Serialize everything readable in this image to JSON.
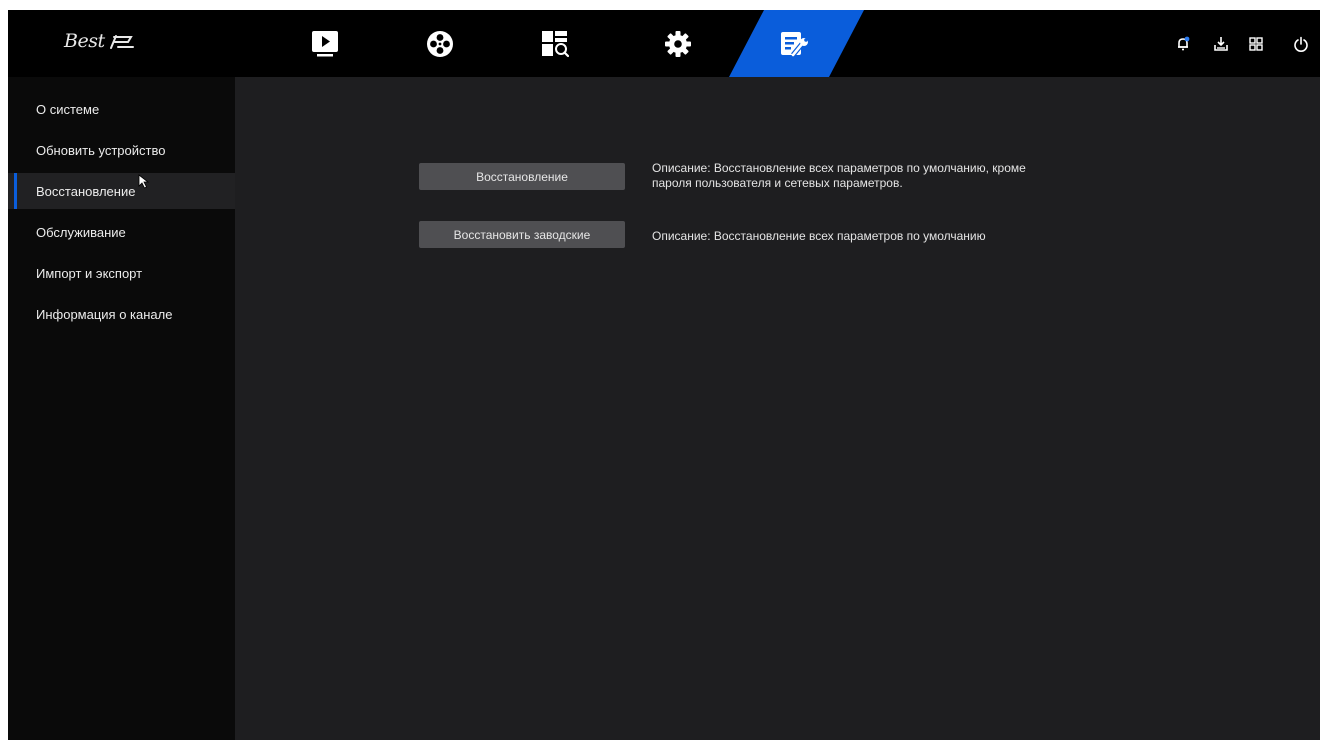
{
  "app": {
    "logo_text": "Best",
    "accent_color": "#0a5ddb"
  },
  "topnav": {
    "tabs": [
      {
        "icon": "play-icon",
        "active": false
      },
      {
        "icon": "film-reel-icon",
        "active": false
      },
      {
        "icon": "search-playback-icon",
        "active": false
      },
      {
        "icon": "gear-icon",
        "active": false
      },
      {
        "icon": "maintenance-icon",
        "active": true
      }
    ],
    "tools": [
      "notification-icon",
      "download-icon",
      "layout-grid-icon",
      "power-icon"
    ]
  },
  "sidebar": {
    "items": [
      {
        "label": "О системе",
        "active": false
      },
      {
        "label": "Обновить устройство",
        "active": false
      },
      {
        "label": "Восстановление",
        "active": true
      },
      {
        "label": "Обслуживание",
        "active": false
      },
      {
        "label": "Импорт и экспорт",
        "active": false
      },
      {
        "label": "Информация о канале",
        "active": false
      }
    ]
  },
  "main": {
    "restore": {
      "button_label": "Восстановление",
      "description_line1": "Описание: Восстановление всех параметров по умолчанию, кроме",
      "description_line2": "пароля пользователя и сетевых параметров."
    },
    "factory": {
      "button_label": "Восстановить заводские",
      "description": "Описание: Восстановление всех параметров по умолчанию"
    }
  }
}
